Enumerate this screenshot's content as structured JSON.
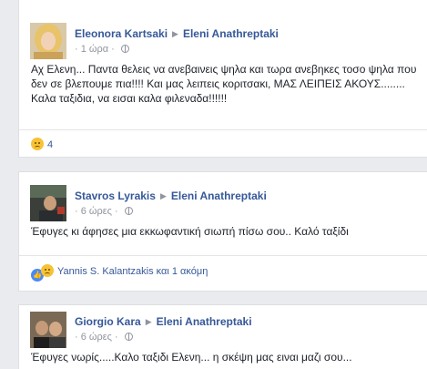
{
  "comments": [
    {
      "author": "Eleonora Kartsaki",
      "target": "Eleni Anathreptaki",
      "time": "1 ώρα",
      "text": "Αχ Ελενη... Παντα θελεις να ανεβαινεις ψηλα και τωρα ανεβηκες τοσο ψηλα που δεν σε βλεπουμε πια!!!! Και μας λειπεις κοριτσακι, ΜΑΣ ΛΕΙΠΕΙΣ ΑΚΟΥΣ........ Καλα ταξιδια, να εισαι καλα φιλεναδα!!!!!!",
      "reactions": {
        "icons": [
          "sad-icon"
        ],
        "count": "4"
      }
    },
    {
      "author": "Stavros Lyrakis",
      "target": "Eleni Anathreptaki",
      "time": "6 ώρες",
      "text": "Έφυγες κι άφησες μια εκκωφαντική σιωπή πίσω σου.. Καλό ταξίδι",
      "reactions": {
        "icons": [
          "like-icon",
          "sad-icon"
        ],
        "names": "Yannis S. Kalantzakis και 1 ακόμη"
      }
    },
    {
      "author": "Giorgio Kara",
      "target": "Eleni Anathreptaki",
      "time": "6 ώρες",
      "text": "Έφυγες νωρίς.....Καλο ταξιδι Ελενη... η σκέψη μας ειναι μαζι σου..."
    }
  ],
  "colors": {
    "link": "#365899",
    "meta": "#90949c",
    "background": "#e9ebee"
  }
}
